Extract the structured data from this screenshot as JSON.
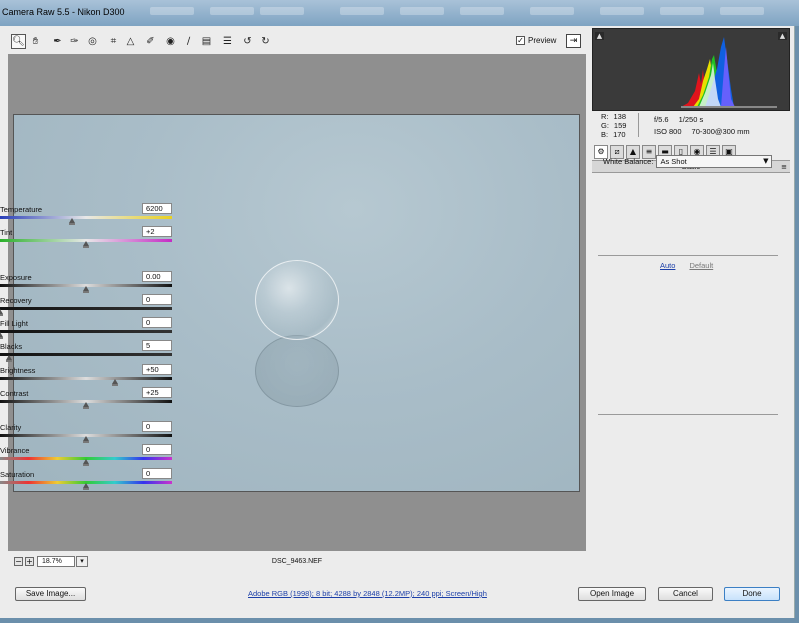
{
  "window": {
    "title": "Camera Raw 5.5  -  Nikon D300"
  },
  "toolbar": {
    "tools": [
      "zoom-tool-icon",
      "hand-tool-icon",
      "white-balance-tool-icon",
      "color-sampler-tool-icon",
      "targeted-adjustment-tool-icon",
      "crop-tool-icon",
      "straighten-tool-icon",
      "spot-removal-tool-icon",
      "red-eye-removal-tool-icon",
      "adjustment-brush-icon",
      "graduated-filter-icon",
      "preferences-icon",
      "rotate-ccw-icon",
      "rotate-cw-icon"
    ],
    "preview_label": "Preview",
    "preview_checked": true
  },
  "status": {
    "zoom": "18.7%",
    "filename": "DSC_9463.NEF"
  },
  "readout": {
    "r_label": "R:",
    "r": "138",
    "g_label": "G:",
    "g": "159",
    "b_label": "B:",
    "b": "170",
    "aperture": "f/5.6",
    "shutter": "1/250 s",
    "iso": "ISO 800",
    "lens": "70-300@300 mm"
  },
  "panel": {
    "title": "Basic",
    "white_balance_label": "White Balance:",
    "white_balance_value": "As Shot",
    "auto": "Auto",
    "default": "Default",
    "sliders": [
      {
        "label": "Temperature",
        "value": "6200",
        "position": 0.42,
        "track": "temp"
      },
      {
        "label": "Tint",
        "value": "+2",
        "position": 0.5,
        "track": "tint"
      },
      {
        "label": "Exposure",
        "value": "0.00",
        "position": 0.5,
        "track": "gray"
      },
      {
        "label": "Recovery",
        "value": "0",
        "position": 0.0,
        "track": "dark"
      },
      {
        "label": "Fill Light",
        "value": "0",
        "position": 0.0,
        "track": "dark"
      },
      {
        "label": "Blacks",
        "value": "5",
        "position": 0.05,
        "track": "dark"
      },
      {
        "label": "Brightness",
        "value": "+50",
        "position": 0.67,
        "track": "gray"
      },
      {
        "label": "Contrast",
        "value": "+25",
        "position": 0.5,
        "track": "gray"
      },
      {
        "label": "Clarity",
        "value": "0",
        "position": 0.5,
        "track": "gray"
      },
      {
        "label": "Vibrance",
        "value": "0",
        "position": 0.5,
        "track": "color"
      },
      {
        "label": "Saturation",
        "value": "0",
        "position": 0.5,
        "track": "color"
      }
    ]
  },
  "bottom": {
    "save_image": "Save Image...",
    "workflow": "Adobe RGB (1998); 8 bit; 4288 by 2848 (12.2MP); 240 ppi; Screen/High",
    "open_image": "Open Image",
    "cancel": "Cancel",
    "done": "Done"
  },
  "colors": {
    "accent": "#1c3fa8",
    "button_primary": "#3b7fc4"
  }
}
